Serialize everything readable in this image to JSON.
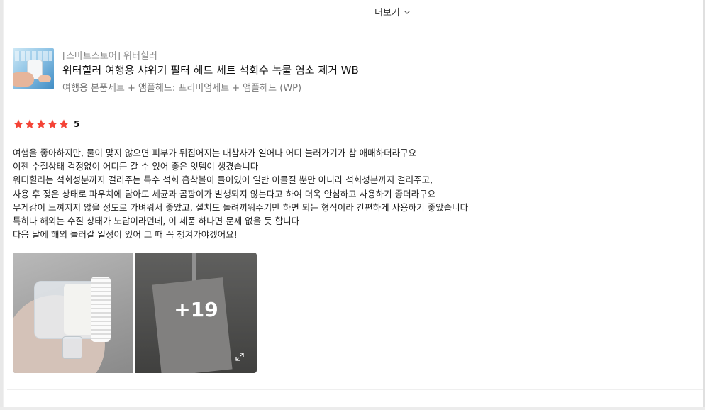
{
  "more": {
    "label": "더보기"
  },
  "product": {
    "store": "[스마트스토어] 워터힐러",
    "title": "워터힐러 여행용 샤워기 필터 헤드 세트 석회수 녹물 염소 제거 WB",
    "option": "여행용 본품세트 + 앰플헤드: 프리미엄세트 + 앰플헤드 (WP)"
  },
  "rating": {
    "stars": 5,
    "score": "5",
    "star_color": "#f44336"
  },
  "review": {
    "lines": [
      "여행을 좋아하지만, 물이 맞지 않으면 피부가 뒤집어지는 대참사가 일어나 어디 놀러가기가 참 애매하더라구요",
      "이젠 수질상태 걱정없이 어디든 갈 수 있어 좋은 잇템이 생겼습니다",
      "워터힐러는 석회성분까지 걸러주는 특수 석회 흡착볼이 들어있어 일반 이물질 뿐만 아니라 석회성분까지 걸러주고,",
      "사용 후 젖은 상태로 파우치에 담아도 세균과 곰팡이가 발생되지 않는다고 하여 더욱 안심하고 사용하기 좋더라구요",
      "무게감이 느껴지지 않을 정도로 가벼워서 좋았고, 설치도 돌려끼워주기만 하면 되는 형식이라 간편하게 사용하기 좋았습니다",
      "특히나 해외는 수질 상태가 노답이라던데, 이 제품 하나면 문제 없을 듯 합니다",
      "다음 달에 해외 놀러갈 일정이 있어 그 때 꼭 챙겨가야겠어요!"
    ]
  },
  "photos": {
    "more_count": "+19"
  }
}
